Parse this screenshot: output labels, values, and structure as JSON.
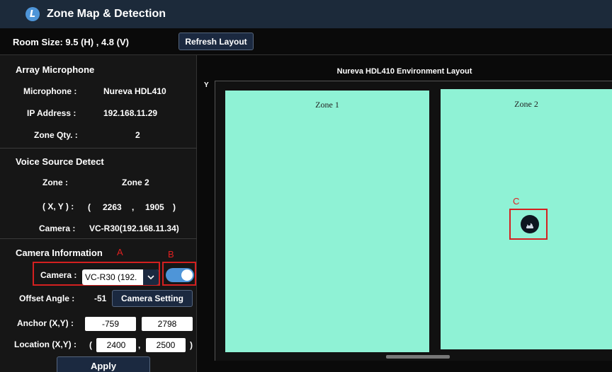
{
  "window": {
    "title": "Zone Map & Detection",
    "logo_letter": "L"
  },
  "room": {
    "size_text": "Room Size:  9.5  (H)  ,  4.8  (V)",
    "refresh_label": "Refresh Layout"
  },
  "array_mic": {
    "title": "Array Microphone",
    "microphone_label": "Microphone :",
    "microphone_value": "Nureva HDL410",
    "ip_label": "IP Address :",
    "ip_value": "192.168.11.29",
    "zone_qty_label": "Zone Qty. :",
    "zone_qty_value": "2"
  },
  "voice_source": {
    "title": "Voice Source Detect",
    "zone_label": "Zone :",
    "zone_value": "Zone 2",
    "xy_label": "( X, Y ) :",
    "paren_open": "(",
    "x_value": "2263",
    "comma": ",",
    "y_value": "1905",
    "paren_close": ")",
    "camera_label": "Camera :",
    "camera_value": "VC-R30(192.168.11.34)"
  },
  "camera_info": {
    "title": "Camera Information",
    "camera_label": "Camera :",
    "camera_selected": "VC-R30 (192.",
    "offset_label": "Offset Angle :",
    "offset_value": "-51",
    "camera_setting_label": "Camera Setting",
    "anchor_label": "Anchor (X,Y) :",
    "anchor_x": "-759",
    "anchor_y": "2798",
    "location_label": "Location (X,Y) :",
    "loc_open": "(",
    "location_x": "2400",
    "loc_comma": ",",
    "location_y": "2500",
    "loc_close": ")",
    "apply_label": "Apply",
    "toggle_on": true
  },
  "annotations": {
    "a": "A",
    "b": "B",
    "c": "C"
  },
  "layout": {
    "title": "Nureva HDL410 Environment Layout",
    "y_axis_label": "Y",
    "zones": [
      {
        "name": "Zone 1"
      },
      {
        "name": "Zone 2"
      }
    ]
  },
  "icons": {
    "logo": "app-logo-icon",
    "camera": "ptz-camera-icon",
    "dropdown": "chevron-down-icon"
  },
  "colors": {
    "titlebar": "#1c2a3a",
    "zone_fill": "#8ff2d5",
    "accent": "#4e95d8",
    "annotation": "#d42020"
  }
}
